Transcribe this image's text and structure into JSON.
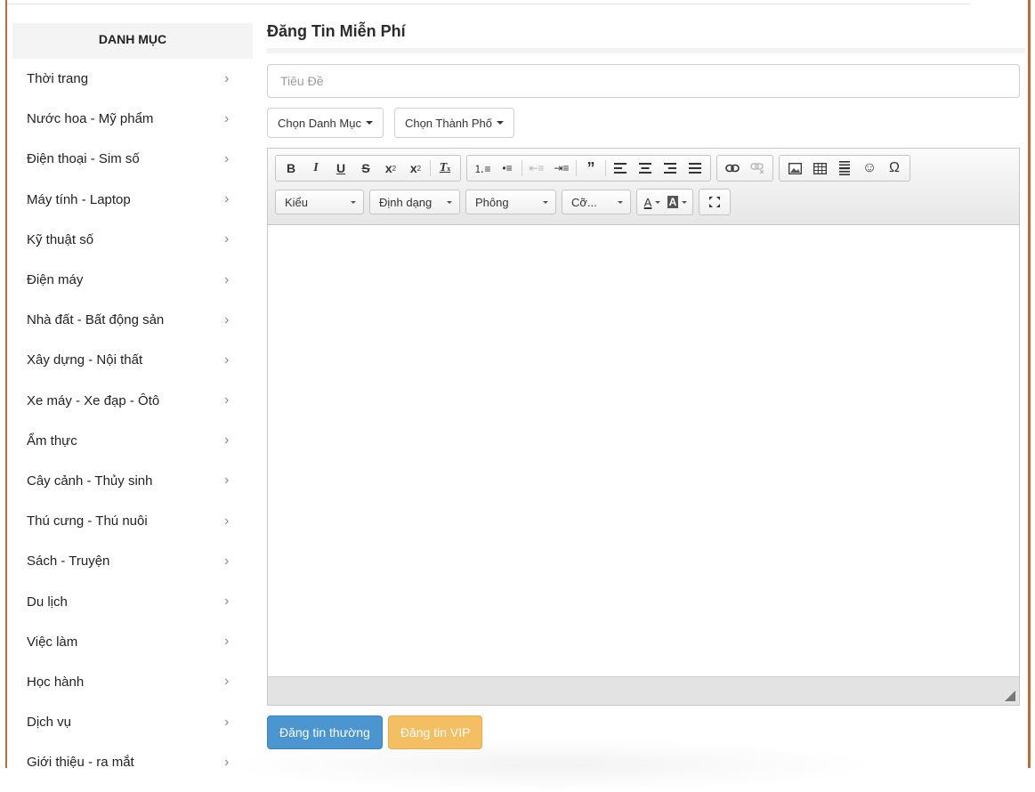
{
  "sidebar": {
    "title": "DANH MỤC",
    "items": [
      "Thời trang",
      "Nước hoa - Mỹ phẩm",
      "Điện thoại - Sim số",
      "Máy tính - Laptop",
      "Kỹ thuật số",
      "Điện máy",
      "Nhà đất - Bất động sản",
      "Xây dựng - Nội thất",
      "Xe máy - Xe đạp - Ôtô",
      "Ẩm thực",
      "Cây cảnh - Thủy sinh",
      "Thú cưng - Thú nuôi",
      "Sách - Truyện",
      "Du lịch",
      "Việc làm",
      "Học hành",
      "Dịch vụ",
      "Giới thiệu - ra mắt"
    ]
  },
  "main": {
    "title": "Đăng Tin Miễn Phí",
    "title_placeholder": "Tiêu Đề",
    "category_dropdown": "Chọn Danh Mục",
    "city_dropdown": "Chọn Thành Phố",
    "editor": {
      "style_combo": "Kiểu",
      "format_combo": "Định dạng",
      "font_combo": "Phông",
      "size_combo": "Cỡ..."
    },
    "buttons": {
      "normal": "Đăng tin thường",
      "vip": "Đăng tin VIP"
    }
  },
  "colors": {
    "accent": "#c06a35",
    "primary_button": "#4b95d0",
    "vip_button": "#f4be62"
  }
}
